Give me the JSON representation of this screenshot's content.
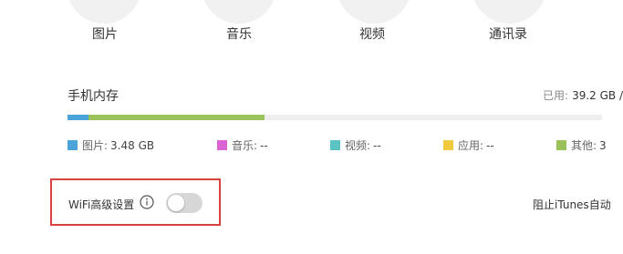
{
  "categories": [
    {
      "label": "图片"
    },
    {
      "label": "音乐"
    },
    {
      "label": "视频"
    },
    {
      "label": "通讯录"
    }
  ],
  "memory": {
    "title": "手机内存",
    "used_label": "已用:",
    "used_value": "39.2 GB /",
    "bar": {
      "track_color": "#eeeeee",
      "segments": [
        {
          "name": "photos",
          "fraction": 0.04,
          "color": "#4aa3d9"
        },
        {
          "name": "other",
          "fraction": 0.33,
          "color": "#9bc25a"
        }
      ]
    },
    "legend": [
      {
        "label": "图片:",
        "value": "3.48 GB",
        "color": "#4aa3d9"
      },
      {
        "label": "音乐:",
        "value": "--",
        "color": "#d963d2"
      },
      {
        "label": "视频:",
        "value": "--",
        "color": "#5bc4c3"
      },
      {
        "label": "应用:",
        "value": "--",
        "color": "#f0c93e"
      },
      {
        "label": "其他:",
        "value": "3",
        "color": "#9bc25a"
      }
    ]
  },
  "wifi": {
    "label": "WiFi高级设置",
    "info_icon": "info-circle-icon",
    "toggle_on": false,
    "highlight_color": "#d9433f"
  },
  "itunes": {
    "label": "阻止iTunes自动"
  }
}
